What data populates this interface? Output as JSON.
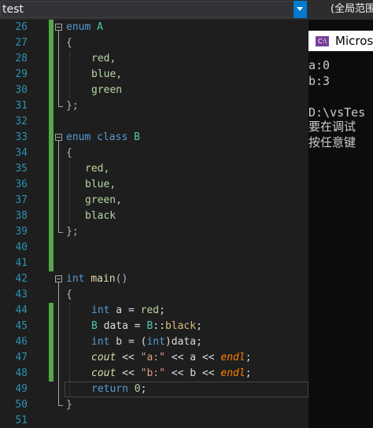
{
  "toolbar": {
    "project_scope": "test",
    "scope_right": "(全局范围"
  },
  "editor": {
    "line_numbers": [
      "26",
      "27",
      "28",
      "29",
      "30",
      "31",
      "32",
      "33",
      "34",
      "35",
      "36",
      "37",
      "38",
      "39",
      "40",
      "41",
      "42",
      "43",
      "44",
      "45",
      "46",
      "47",
      "48",
      "49",
      "50",
      "51"
    ]
  },
  "code": {
    "l26_kw": "enum",
    "l26_name": "A",
    "l27": "{",
    "l28": "red,",
    "l29": "blue,",
    "l30": "green",
    "l31": "};",
    "l33_kw": "enum class",
    "l33_name": "B",
    "l34": "{",
    "l35": "red,",
    "l36": "blue,",
    "l37": "green,",
    "l38": "black",
    "l39": "};",
    "l42_kw": "int",
    "l42_fn": "main",
    "l42_paren": "()",
    "l43": "{",
    "l44_kw": "int",
    "l44_rest": " a = ",
    "l44_val": "red",
    "l44_end": ";",
    "l45_type": "B",
    "l45_rest": " data = ",
    "l45_scope": "B",
    "l45_sep": "::",
    "l45_val": "black",
    "l45_end": ";",
    "l46_kw": "int",
    "l46_rest": " b = (",
    "l46_kw2": "int",
    "l46_end": ")data;",
    "l47_cout": "cout",
    "l47_op": " << ",
    "l47_str": "\"a:\"",
    "l47_mid": " << a << ",
    "l47_endl": "endl",
    "l47_end": ";",
    "l48_cout": "cout",
    "l48_op": " << ",
    "l48_str": "\"b:\"",
    "l48_mid": " << b << ",
    "l48_endl": "endl",
    "l48_end": ";",
    "l49_kw": "return",
    "l49_num": " 0",
    "l49_end": ";",
    "l50": "}"
  },
  "console": {
    "title": "Micros",
    "icon_text": "C:\\",
    "lines": [
      "a:0",
      "b:3",
      "",
      "D:\\vsTes",
      "要在调试",
      "按任意键"
    ]
  }
}
